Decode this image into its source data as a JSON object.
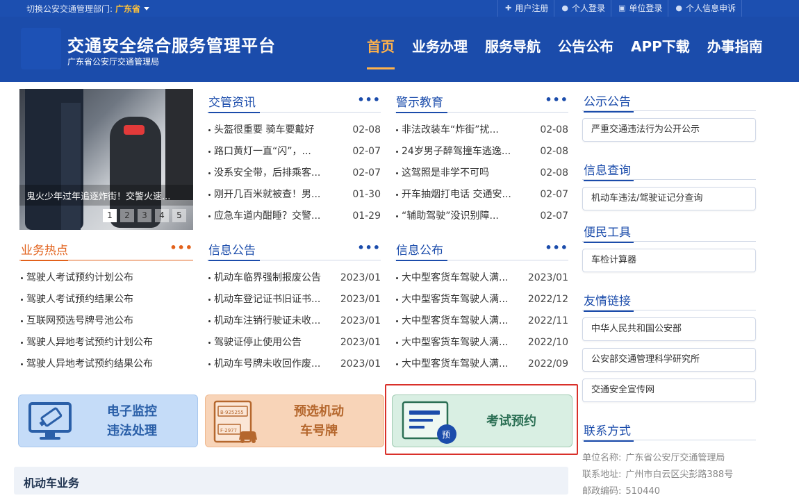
{
  "topbar": {
    "dept_label": "切换公安交通管理部门:",
    "dept_value": "广东省",
    "links": [
      "用户注册",
      "个人登录",
      "单位登录",
      "个人信息申诉"
    ],
    "link_icons": [
      "plus-icon",
      "user-icon",
      "building-icon",
      "user-appeal-icon"
    ]
  },
  "header": {
    "title": "交通安全综合服务管理平台",
    "subtitle": "广东省公安厅交通管理局",
    "nav": [
      "首页",
      "业务办理",
      "服务导航",
      "公告公布",
      "APP下载",
      "办事指南"
    ],
    "active_nav": "首页"
  },
  "carousel": {
    "caption": "鬼火少年过年追逐炸街！交警火速...",
    "pages": [
      "1",
      "2",
      "3",
      "4",
      "5"
    ],
    "active_page": "1"
  },
  "news": {
    "title": "交管资讯",
    "more": "•••",
    "items": [
      {
        "text": "头盔很重要 骑车要戴好",
        "date": "02-08"
      },
      {
        "text": "路口黄灯一直“闪”，...",
        "date": "02-07"
      },
      {
        "text": "没系安全带，后排乘客...",
        "date": "02-07"
      },
      {
        "text": "刚开几百米就被查！男...",
        "date": "01-30"
      },
      {
        "text": "应急车道内酣睡？交警...",
        "date": "01-29"
      }
    ]
  },
  "warning": {
    "title": "警示教育",
    "more": "•••",
    "items": [
      {
        "text": "非法改装车“炸街”扰...",
        "date": "02-08"
      },
      {
        "text": "24岁男子醉驾撞车逃逸...",
        "date": "02-08"
      },
      {
        "text": "这驾照是非学不可吗",
        "date": "02-08"
      },
      {
        "text": "开车抽烟打电话 交通安...",
        "date": "02-07"
      },
      {
        "text": "“辅助驾驶”没识别障...",
        "date": "02-07"
      }
    ]
  },
  "hot": {
    "title": "业务热点",
    "more": "•••",
    "items": [
      {
        "text": "驾驶人考试预约计划公布"
      },
      {
        "text": "驾驶人考试预约结果公布"
      },
      {
        "text": "互联网预选号牌号池公布"
      },
      {
        "text": "驾驶人异地考试预约计划公布"
      },
      {
        "text": "驾驶人异地考试预约结果公布"
      }
    ]
  },
  "notice": {
    "title": "信息公告",
    "more": "•••",
    "items": [
      {
        "text": "机动车临界强制报废公告",
        "date": "2023/01"
      },
      {
        "text": "机动车登记证书旧证书...",
        "date": "2023/01"
      },
      {
        "text": "机动车注销行驶证未收...",
        "date": "2023/01"
      },
      {
        "text": "驾驶证停止使用公告",
        "date": "2023/01"
      },
      {
        "text": "机动车号牌未收回作废...",
        "date": "2023/01"
      }
    ]
  },
  "publish": {
    "title": "信息公布",
    "more": "•••",
    "items": [
      {
        "text": "大中型客货车驾驶人满...",
        "date": "2023/01"
      },
      {
        "text": "大中型客货车驾驶人满...",
        "date": "2022/12"
      },
      {
        "text": "大中型客货车驾驶人满...",
        "date": "2022/11"
      },
      {
        "text": "大中型客货车驾驶人满...",
        "date": "2022/10"
      },
      {
        "text": "大中型客货车驾驶人满...",
        "date": "2022/09"
      }
    ]
  },
  "tiles": {
    "t1": {
      "line1": "电子监控",
      "line2": "违法处理",
      "icon": "monitor-camera-icon"
    },
    "t2": {
      "line1": "预选机动",
      "line2": "车号牌",
      "icon": "license-plate-car-icon",
      "plate1": "B·925255",
      "plate2": "F·2977"
    },
    "t3": {
      "label": "考试预约",
      "icon": "exam-card-icon",
      "badge": "预"
    }
  },
  "motor_section": {
    "title": "机动车业务"
  },
  "right": {
    "public": {
      "title": "公示公告",
      "items": [
        "严重交通违法行为公开公示"
      ]
    },
    "query": {
      "title": "信息查询",
      "items": [
        "机动车违法/驾驶证记分查询"
      ]
    },
    "tools": {
      "title": "便民工具",
      "items": [
        "车检计算器"
      ]
    },
    "links": {
      "title": "友情链接",
      "items": [
        "中华人民共和国公安部",
        "公安部交通管理科学研究所",
        "交通安全宣传网"
      ]
    },
    "contact": {
      "title": "联系方式",
      "unit_label": "单位名称:",
      "unit": "广东省公安厅交通管理局",
      "addr_label": "联系地址:",
      "addr": "广州市白云区尖彭路388号",
      "zip_label": "邮政编码:",
      "zip": "510440"
    }
  },
  "colors": {
    "primary": "#1b4cab",
    "accent": "#ffb24a",
    "hot": "#e2611b",
    "highlight": "#d9302a"
  }
}
